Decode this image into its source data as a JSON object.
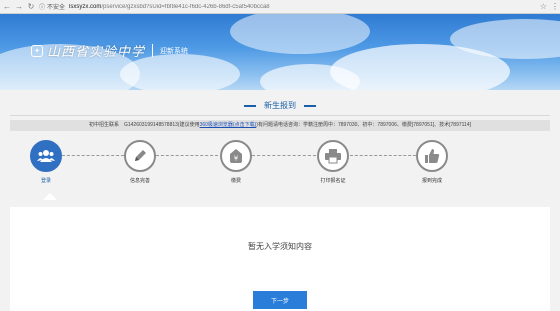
{
  "browser": {
    "security_label": "不安全",
    "url_host": "lsxsyzx.com",
    "url_path": "/pservice/gzxsbd?sUid=fbf8e41c-f6dc-426b-86df-c5af540bcca8"
  },
  "banner": {
    "school_name": "山西省实验中学",
    "system_name": "迎新系统"
  },
  "section": {
    "title": "新生报到"
  },
  "notice": {
    "prefix": "初中招生联系　G142603199148578813(建议使用",
    "link": "360极速浏览器(点击下载)",
    "suffix": ")有问题请电话咨询：学籍注册周中：7897030、初中：7897006、缴费[7897051]、技术[7897114]"
  },
  "steps": [
    {
      "label": "登录",
      "icon": "users-icon",
      "active": true
    },
    {
      "label": "信息完善",
      "icon": "pencil-icon",
      "active": false
    },
    {
      "label": "缴费",
      "icon": "money-tag-icon",
      "active": false
    },
    {
      "label": "打印报名证",
      "icon": "printer-icon",
      "active": false
    },
    {
      "label": "报到完成",
      "icon": "thumbs-up-icon",
      "active": false
    }
  ],
  "panel": {
    "empty_message": "暂无入学须知内容",
    "next_label": "下一步"
  },
  "colors": {
    "accent": "#1b5fa8",
    "button": "#2a7dd8",
    "active_step": "#3070c3"
  }
}
